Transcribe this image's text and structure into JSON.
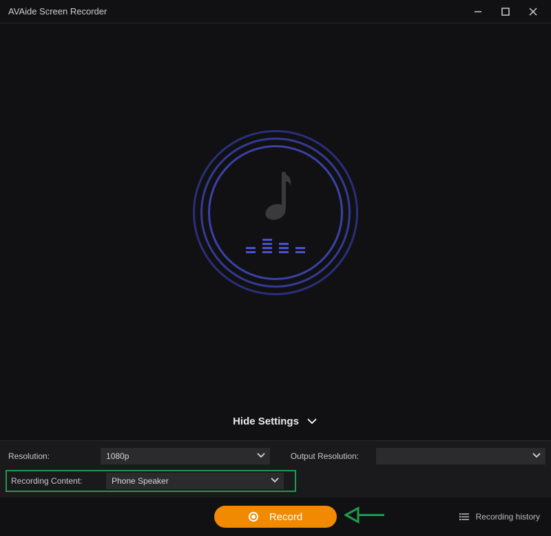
{
  "title": "AVAide Screen Recorder",
  "central": {
    "icon": "music-note"
  },
  "hideSettingsLabel": "Hide Settings",
  "settings": {
    "resolution": {
      "label": "Resolution:",
      "value": "1080p"
    },
    "outputResolution": {
      "label": "Output Resolution:",
      "value": ""
    },
    "recordingContent": {
      "label": "Recording Content:",
      "value": "Phone Speaker"
    }
  },
  "record": {
    "label": "Record"
  },
  "history": {
    "label": "Recording history"
  }
}
